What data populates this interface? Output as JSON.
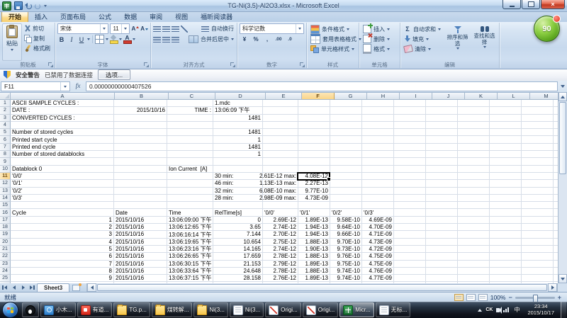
{
  "titlebar": {
    "title": "TG-Ni(3.5)-Al2O3.xlsx - Microsoft Excel"
  },
  "ribbon": {
    "tabs": [
      {
        "label": "开始",
        "active": true
      },
      {
        "label": "插入"
      },
      {
        "label": "页面布局"
      },
      {
        "label": "公式"
      },
      {
        "label": "数据"
      },
      {
        "label": "审阅"
      },
      {
        "label": "视图"
      },
      {
        "label": "福昕阅读器"
      }
    ],
    "clipboard": {
      "group": "剪贴板",
      "paste": "粘贴",
      "cut": "剪切",
      "copy": "复制",
      "format_painter": "格式刷"
    },
    "font": {
      "group": "字体",
      "font_name": "宋体",
      "font_size": "11",
      "bold": "B",
      "italic": "I",
      "underline": "U",
      "grow_font": "A",
      "shrink_font": "A",
      "font_color": "A"
    },
    "alignment": {
      "group": "对齐方式",
      "wrap_text": "自动换行",
      "merge_center": "合并后居中"
    },
    "number": {
      "group": "数字",
      "format": "科学记数",
      "accounting": "¥",
      "percent": "%",
      "comma": ",",
      "add_decimal": ".00",
      "remove_decimal": ".0"
    },
    "styles": {
      "group": "样式",
      "items": [
        "条件格式",
        "套用表格格式",
        "单元格样式"
      ]
    },
    "cells": {
      "group": "单元格",
      "items": [
        "插入",
        "删除",
        "格式"
      ]
    },
    "editing": {
      "group": "编辑",
      "sigma": "Σ",
      "small_items": [
        "自动求和",
        "填充",
        "清除"
      ],
      "large_items": [
        "排序和筛选",
        "查找和选择"
      ]
    }
  },
  "message_bar": {
    "title": "安全警告",
    "message": "已禁用了数据连接",
    "button": "选项..."
  },
  "formula_bar": {
    "name_box": "F11",
    "fx_label": "fx",
    "value": "0.00000000000407526"
  },
  "grid": {
    "columns": [
      "A",
      "B",
      "C",
      "D",
      "E",
      "F",
      "G",
      "H",
      "I",
      "J",
      "K",
      "L",
      "M",
      "N"
    ],
    "selected": {
      "cell": "F11",
      "col": "F",
      "row": 11
    },
    "rows": [
      {
        "n": 1,
        "cells": [
          {
            "c": 0,
            "t": "ASCII SAMPLE CYCLES :"
          },
          {
            "c": 3,
            "t": "1.mdc"
          }
        ]
      },
      {
        "n": 2,
        "cells": [
          {
            "c": 0,
            "t": "DATE :"
          },
          {
            "c": 1,
            "t": "2015/10/16",
            "a": "r"
          },
          {
            "c": 2,
            "t": "TIME :",
            "a": "r"
          },
          {
            "c": 3,
            "t": "13:06:09 下午"
          }
        ]
      },
      {
        "n": 3,
        "cells": [
          {
            "c": 0,
            "t": "CONVERTED CYCLES :"
          },
          {
            "c": 3,
            "t": "1481",
            "a": "r"
          }
        ]
      },
      {
        "n": 4,
        "cells": []
      },
      {
        "n": 5,
        "cells": [
          {
            "c": 0,
            "t": "Number of stored cycles"
          },
          {
            "c": 3,
            "t": "1481",
            "a": "r"
          }
        ]
      },
      {
        "n": 6,
        "cells": [
          {
            "c": 0,
            "t": "Printed start cycle"
          },
          {
            "c": 3,
            "t": "1",
            "a": "r"
          }
        ]
      },
      {
        "n": 7,
        "cells": [
          {
            "c": 0,
            "t": "Printed end cycle"
          },
          {
            "c": 3,
            "t": "1481",
            "a": "r"
          }
        ]
      },
      {
        "n": 8,
        "cells": [
          {
            "c": 0,
            "t": "Number of stored datablocks"
          },
          {
            "c": 3,
            "t": "1",
            "a": "r"
          }
        ]
      },
      {
        "n": 9,
        "cells": []
      },
      {
        "n": 10,
        "cells": [
          {
            "c": 0,
            "t": "Datablock 0"
          },
          {
            "c": 2,
            "t": "Ion Current  [A]"
          }
        ]
      },
      {
        "n": 11,
        "cells": [
          {
            "c": 0,
            "t": "'0/0'"
          },
          {
            "c": 3,
            "t": "30 min:"
          },
          {
            "c": 4,
            "t": "2.61E-12 max:",
            "a": "r"
          },
          {
            "c": 5,
            "t": "4.08E-12",
            "a": "r"
          }
        ]
      },
      {
        "n": 12,
        "cells": [
          {
            "c": 0,
            "t": "'0/1'"
          },
          {
            "c": 3,
            "t": "46 min:"
          },
          {
            "c": 4,
            "t": "1.13E-13 max:",
            "a": "r"
          },
          {
            "c": 5,
            "t": "2.27E-13",
            "a": "r"
          }
        ]
      },
      {
        "n": 13,
        "cells": [
          {
            "c": 0,
            "t": "'0/2'"
          },
          {
            "c": 3,
            "t": "32 min:"
          },
          {
            "c": 4,
            "t": "6.08E-10 max:",
            "a": "r"
          },
          {
            "c": 5,
            "t": "9.77E-10",
            "a": "r"
          }
        ]
      },
      {
        "n": 14,
        "cells": [
          {
            "c": 0,
            "t": "'0/3'"
          },
          {
            "c": 3,
            "t": "28 min:"
          },
          {
            "c": 4,
            "t": "2.98E-09 max:",
            "a": "r"
          },
          {
            "c": 5,
            "t": "4.73E-09",
            "a": "r"
          }
        ]
      },
      {
        "n": 15,
        "cells": []
      },
      {
        "n": 16,
        "cells": [
          {
            "c": 0,
            "t": "Cycle"
          },
          {
            "c": 1,
            "t": "Date"
          },
          {
            "c": 2,
            "t": "Time"
          },
          {
            "c": 3,
            "t": "RelTime[s]"
          },
          {
            "c": 4,
            "t": "'0/0'"
          },
          {
            "c": 5,
            "t": "'0/1'"
          },
          {
            "c": 6,
            "t": "'0/2'"
          },
          {
            "c": 7,
            "t": "'0/3'"
          }
        ]
      },
      {
        "n": 17,
        "cells": [
          {
            "c": 0,
            "t": "1",
            "a": "r"
          },
          {
            "c": 1,
            "t": "2015/10/16"
          },
          {
            "c": 2,
            "t": "13:06:09:00 下午"
          },
          {
            "c": 3,
            "t": "0",
            "a": "r"
          },
          {
            "c": 4,
            "t": "2.69E-12",
            "a": "r"
          },
          {
            "c": 5,
            "t": "1.89E-13",
            "a": "r"
          },
          {
            "c": 6,
            "t": "9.58E-10",
            "a": "r"
          },
          {
            "c": 7,
            "t": "4.69E-09",
            "a": "r"
          }
        ]
      },
      {
        "n": 18,
        "cells": [
          {
            "c": 0,
            "t": "2",
            "a": "r"
          },
          {
            "c": 1,
            "t": "2015/10/16"
          },
          {
            "c": 2,
            "t": "13:06:12:65 下午"
          },
          {
            "c": 3,
            "t": "3.65",
            "a": "r"
          },
          {
            "c": 4,
            "t": "2.74E-12",
            "a": "r"
          },
          {
            "c": 5,
            "t": "1.94E-13",
            "a": "r"
          },
          {
            "c": 6,
            "t": "9.64E-10",
            "a": "r"
          },
          {
            "c": 7,
            "t": "4.70E-09",
            "a": "r"
          }
        ]
      },
      {
        "n": 19,
        "cells": [
          {
            "c": 0,
            "t": "3",
            "a": "r"
          },
          {
            "c": 1,
            "t": "2015/10/16"
          },
          {
            "c": 2,
            "t": "13:06:16:14 下午"
          },
          {
            "c": 3,
            "t": "7.144",
            "a": "r"
          },
          {
            "c": 4,
            "t": "2.70E-12",
            "a": "r"
          },
          {
            "c": 5,
            "t": "1.94E-13",
            "a": "r"
          },
          {
            "c": 6,
            "t": "9.66E-10",
            "a": "r"
          },
          {
            "c": 7,
            "t": "4.71E-09",
            "a": "r"
          }
        ]
      },
      {
        "n": 20,
        "cells": [
          {
            "c": 0,
            "t": "4",
            "a": "r"
          },
          {
            "c": 1,
            "t": "2015/10/16"
          },
          {
            "c": 2,
            "t": "13:06:19:65 下午"
          },
          {
            "c": 3,
            "t": "10.654",
            "a": "r"
          },
          {
            "c": 4,
            "t": "2.75E-12",
            "a": "r"
          },
          {
            "c": 5,
            "t": "1.88E-13",
            "a": "r"
          },
          {
            "c": 6,
            "t": "9.70E-10",
            "a": "r"
          },
          {
            "c": 7,
            "t": "4.73E-09",
            "a": "r"
          }
        ]
      },
      {
        "n": 21,
        "cells": [
          {
            "c": 0,
            "t": "5",
            "a": "r"
          },
          {
            "c": 1,
            "t": "2015/10/16"
          },
          {
            "c": 2,
            "t": "13:06:23:16 下午"
          },
          {
            "c": 3,
            "t": "14.165",
            "a": "r"
          },
          {
            "c": 4,
            "t": "2.74E-12",
            "a": "r"
          },
          {
            "c": 5,
            "t": "1.90E-13",
            "a": "r"
          },
          {
            "c": 6,
            "t": "9.73E-10",
            "a": "r"
          },
          {
            "c": 7,
            "t": "4.72E-09",
            "a": "r"
          }
        ]
      },
      {
        "n": 22,
        "cells": [
          {
            "c": 0,
            "t": "6",
            "a": "r"
          },
          {
            "c": 1,
            "t": "2015/10/16"
          },
          {
            "c": 2,
            "t": "13:06:26:65 下午"
          },
          {
            "c": 3,
            "t": "17.659",
            "a": "r"
          },
          {
            "c": 4,
            "t": "2.78E-12",
            "a": "r"
          },
          {
            "c": 5,
            "t": "1.88E-13",
            "a": "r"
          },
          {
            "c": 6,
            "t": "9.76E-10",
            "a": "r"
          },
          {
            "c": 7,
            "t": "4.75E-09",
            "a": "r"
          }
        ]
      },
      {
        "n": 23,
        "cells": [
          {
            "c": 0,
            "t": "7",
            "a": "r"
          },
          {
            "c": 1,
            "t": "2015/10/16"
          },
          {
            "c": 2,
            "t": "13:06:30:15 下午"
          },
          {
            "c": 3,
            "t": "21.153",
            "a": "r"
          },
          {
            "c": 4,
            "t": "2.79E-12",
            "a": "r"
          },
          {
            "c": 5,
            "t": "1.89E-13",
            "a": "r"
          },
          {
            "c": 6,
            "t": "9.75E-10",
            "a": "r"
          },
          {
            "c": 7,
            "t": "4.75E-09",
            "a": "r"
          }
        ]
      },
      {
        "n": 24,
        "cells": [
          {
            "c": 0,
            "t": "8",
            "a": "r"
          },
          {
            "c": 1,
            "t": "2015/10/16"
          },
          {
            "c": 2,
            "t": "13:06:33:64 下午"
          },
          {
            "c": 3,
            "t": "24.648",
            "a": "r"
          },
          {
            "c": 4,
            "t": "2.78E-12",
            "a": "r"
          },
          {
            "c": 5,
            "t": "1.88E-13",
            "a": "r"
          },
          {
            "c": 6,
            "t": "9.74E-10",
            "a": "r"
          },
          {
            "c": 7,
            "t": "4.76E-09",
            "a": "r"
          }
        ]
      },
      {
        "n": 25,
        "cells": [
          {
            "c": 0,
            "t": "9",
            "a": "r"
          },
          {
            "c": 1,
            "t": "2015/10/16"
          },
          {
            "c": 2,
            "t": "13:06:37:15 下午"
          },
          {
            "c": 3,
            "t": "28.158",
            "a": "r"
          },
          {
            "c": 4,
            "t": "2.76E-12",
            "a": "r"
          },
          {
            "c": 5,
            "t": "1.89E-13",
            "a": "r"
          },
          {
            "c": 6,
            "t": "9.74E-10",
            "a": "r"
          },
          {
            "c": 7,
            "t": "4.77E-09",
            "a": "r"
          }
        ]
      },
      {
        "n": 26,
        "cells": []
      }
    ]
  },
  "sheet_bar": {
    "tabs": [
      {
        "label": "Sheet3",
        "active": true
      }
    ]
  },
  "status_bar": {
    "mode": "就绪",
    "zoom": "100%"
  },
  "taskbar": {
    "buttons": [
      {
        "icon": "qq",
        "label": ""
      },
      {
        "icon": "browser",
        "label": "小木..."
      },
      {
        "icon": "youdao",
        "label": "有道..."
      },
      {
        "icon": "folder",
        "label": "TG.p..."
      },
      {
        "icon": "folder",
        "label": "煤转解..."
      },
      {
        "icon": "folder",
        "label": "Ni(3..."
      },
      {
        "icon": "notepad",
        "label": "Ni(3..."
      },
      {
        "icon": "origin",
        "label": "Origi..."
      },
      {
        "icon": "origin",
        "label": "Origi..."
      },
      {
        "icon": "excel",
        "label": "Micr...",
        "active": true
      },
      {
        "icon": "notepad",
        "label": "无标..."
      }
    ],
    "tray": {
      "ck": "CK",
      "lang": "中",
      "time": "23:34",
      "date": "2015/10/17"
    }
  },
  "overlay": {
    "ball_score": "90"
  }
}
